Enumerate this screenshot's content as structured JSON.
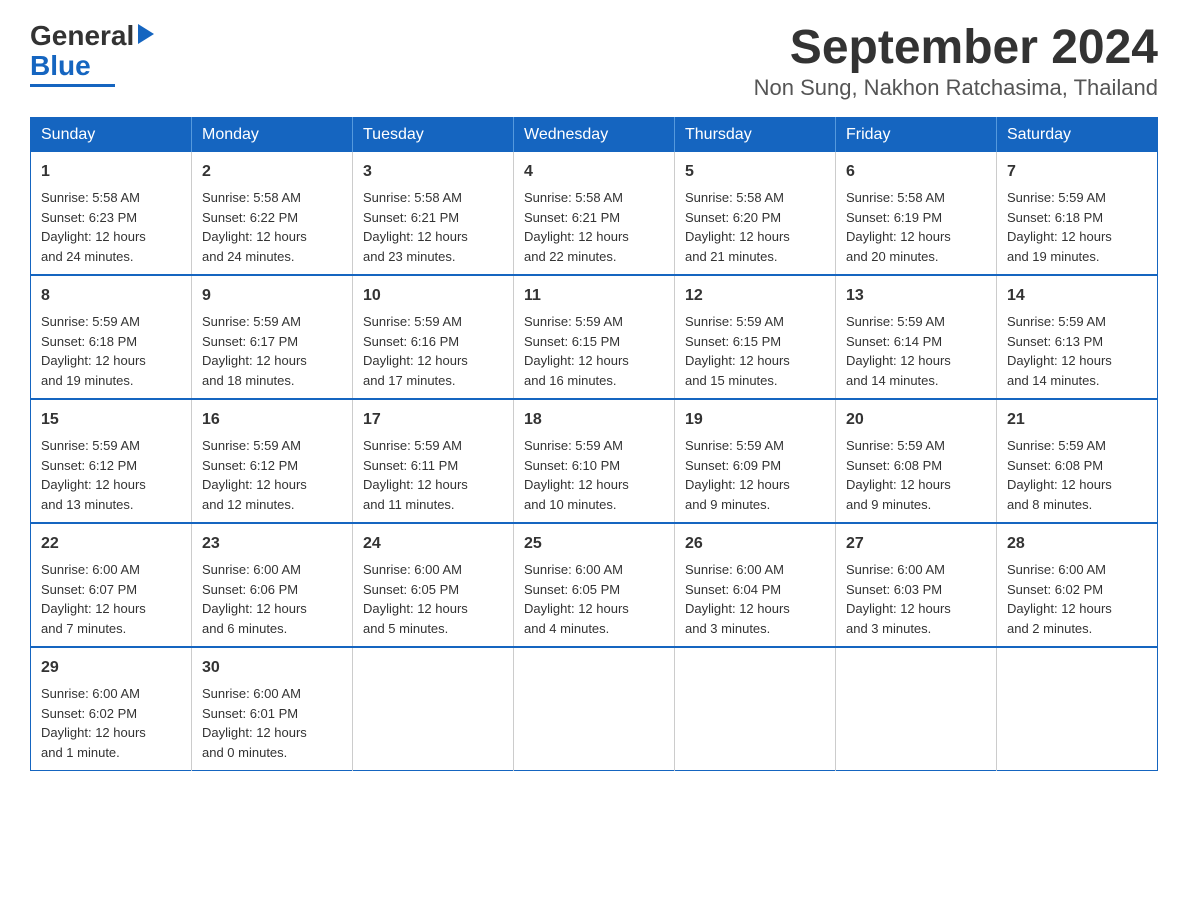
{
  "logo": {
    "text_general": "General",
    "text_blue": "Blue"
  },
  "title": "September 2024",
  "subtitle": "Non Sung, Nakhon Ratchasima, Thailand",
  "days": [
    "Sunday",
    "Monday",
    "Tuesday",
    "Wednesday",
    "Thursday",
    "Friday",
    "Saturday"
  ],
  "weeks": [
    [
      {
        "day": "1",
        "sunrise": "5:58 AM",
        "sunset": "6:23 PM",
        "daylight_hours": "12",
        "daylight_minutes": "24"
      },
      {
        "day": "2",
        "sunrise": "5:58 AM",
        "sunset": "6:22 PM",
        "daylight_hours": "12",
        "daylight_minutes": "24"
      },
      {
        "day": "3",
        "sunrise": "5:58 AM",
        "sunset": "6:21 PM",
        "daylight_hours": "12",
        "daylight_minutes": "23"
      },
      {
        "day": "4",
        "sunrise": "5:58 AM",
        "sunset": "6:21 PM",
        "daylight_hours": "12",
        "daylight_minutes": "22"
      },
      {
        "day": "5",
        "sunrise": "5:58 AM",
        "sunset": "6:20 PM",
        "daylight_hours": "12",
        "daylight_minutes": "21"
      },
      {
        "day": "6",
        "sunrise": "5:58 AM",
        "sunset": "6:19 PM",
        "daylight_hours": "12",
        "daylight_minutes": "20"
      },
      {
        "day": "7",
        "sunrise": "5:59 AM",
        "sunset": "6:18 PM",
        "daylight_hours": "12",
        "daylight_minutes": "19"
      }
    ],
    [
      {
        "day": "8",
        "sunrise": "5:59 AM",
        "sunset": "6:18 PM",
        "daylight_hours": "12",
        "daylight_minutes": "19"
      },
      {
        "day": "9",
        "sunrise": "5:59 AM",
        "sunset": "6:17 PM",
        "daylight_hours": "12",
        "daylight_minutes": "18"
      },
      {
        "day": "10",
        "sunrise": "5:59 AM",
        "sunset": "6:16 PM",
        "daylight_hours": "12",
        "daylight_minutes": "17"
      },
      {
        "day": "11",
        "sunrise": "5:59 AM",
        "sunset": "6:15 PM",
        "daylight_hours": "12",
        "daylight_minutes": "16"
      },
      {
        "day": "12",
        "sunrise": "5:59 AM",
        "sunset": "6:15 PM",
        "daylight_hours": "12",
        "daylight_minutes": "15"
      },
      {
        "day": "13",
        "sunrise": "5:59 AM",
        "sunset": "6:14 PM",
        "daylight_hours": "12",
        "daylight_minutes": "14"
      },
      {
        "day": "14",
        "sunrise": "5:59 AM",
        "sunset": "6:13 PM",
        "daylight_hours": "12",
        "daylight_minutes": "14"
      }
    ],
    [
      {
        "day": "15",
        "sunrise": "5:59 AM",
        "sunset": "6:12 PM",
        "daylight_hours": "12",
        "daylight_minutes": "13"
      },
      {
        "day": "16",
        "sunrise": "5:59 AM",
        "sunset": "6:12 PM",
        "daylight_hours": "12",
        "daylight_minutes": "12"
      },
      {
        "day": "17",
        "sunrise": "5:59 AM",
        "sunset": "6:11 PM",
        "daylight_hours": "12",
        "daylight_minutes": "11"
      },
      {
        "day": "18",
        "sunrise": "5:59 AM",
        "sunset": "6:10 PM",
        "daylight_hours": "12",
        "daylight_minutes": "10"
      },
      {
        "day": "19",
        "sunrise": "5:59 AM",
        "sunset": "6:09 PM",
        "daylight_hours": "12",
        "daylight_minutes": "9"
      },
      {
        "day": "20",
        "sunrise": "5:59 AM",
        "sunset": "6:08 PM",
        "daylight_hours": "12",
        "daylight_minutes": "9"
      },
      {
        "day": "21",
        "sunrise": "5:59 AM",
        "sunset": "6:08 PM",
        "daylight_hours": "12",
        "daylight_minutes": "8"
      }
    ],
    [
      {
        "day": "22",
        "sunrise": "6:00 AM",
        "sunset": "6:07 PM",
        "daylight_hours": "12",
        "daylight_minutes": "7"
      },
      {
        "day": "23",
        "sunrise": "6:00 AM",
        "sunset": "6:06 PM",
        "daylight_hours": "12",
        "daylight_minutes": "6"
      },
      {
        "day": "24",
        "sunrise": "6:00 AM",
        "sunset": "6:05 PM",
        "daylight_hours": "12",
        "daylight_minutes": "5"
      },
      {
        "day": "25",
        "sunrise": "6:00 AM",
        "sunset": "6:05 PM",
        "daylight_hours": "12",
        "daylight_minutes": "4"
      },
      {
        "day": "26",
        "sunrise": "6:00 AM",
        "sunset": "6:04 PM",
        "daylight_hours": "12",
        "daylight_minutes": "3"
      },
      {
        "day": "27",
        "sunrise": "6:00 AM",
        "sunset": "6:03 PM",
        "daylight_hours": "12",
        "daylight_minutes": "3"
      },
      {
        "day": "28",
        "sunrise": "6:00 AM",
        "sunset": "6:02 PM",
        "daylight_hours": "12",
        "daylight_minutes": "2"
      }
    ],
    [
      {
        "day": "29",
        "sunrise": "6:00 AM",
        "sunset": "6:02 PM",
        "daylight_hours": "12",
        "daylight_minutes": "1"
      },
      {
        "day": "30",
        "sunrise": "6:00 AM",
        "sunset": "6:01 PM",
        "daylight_hours": "12",
        "daylight_minutes": "0"
      },
      null,
      null,
      null,
      null,
      null
    ]
  ],
  "labels": {
    "sunrise": "Sunrise:",
    "sunset": "Sunset:",
    "daylight": "Daylight:"
  },
  "daylight_suffix": "hours",
  "minutes_label_singular": "minute",
  "minutes_label_plural": "minutes",
  "and_label": "and"
}
